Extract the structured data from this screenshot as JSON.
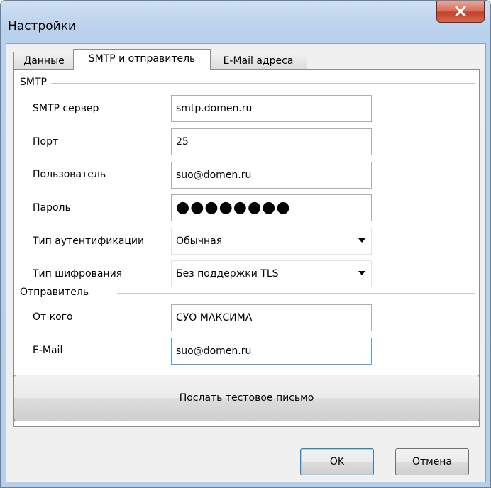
{
  "window": {
    "title": "Настройки"
  },
  "tabs": [
    {
      "label": "Данные",
      "active": false
    },
    {
      "label": "SMTP и отправитель",
      "active": true
    },
    {
      "label": "E-Mail адреса",
      "active": false
    }
  ],
  "smtp": {
    "group_title": "SMTP",
    "server_label": "SMTP сервер",
    "server_value": "smtp.domen.ru",
    "port_label": "Порт",
    "port_value": "25",
    "user_label": "Пользователь",
    "user_value": "suo@domen.ru",
    "password_label": "Пароль",
    "password_value": "●●●●●●●●",
    "auth_label": "Тип аутентификации",
    "auth_value": "Обычная",
    "encryption_label": "Тип шифрования",
    "encryption_value": "Без поддержки TLS"
  },
  "sender": {
    "group_title": "Отправитель",
    "from_label": "От кого",
    "from_value": "СУО МАКСИМА",
    "email_label": "E-Mail",
    "email_value": "suo@domen.ru"
  },
  "actions": {
    "test_button": "Послать тестовое письмо",
    "ok_button": "OK",
    "cancel_button": "Отмена"
  }
}
